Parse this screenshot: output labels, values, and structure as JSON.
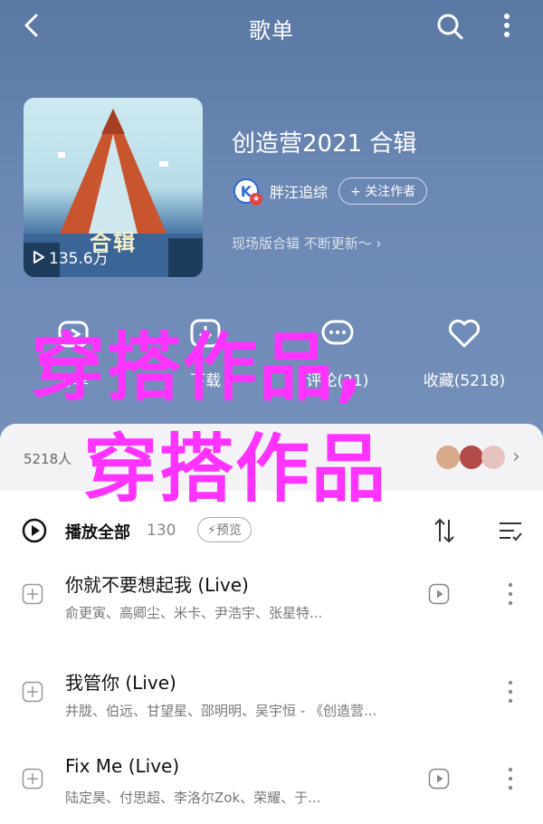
{
  "topbar": {
    "title": "歌单"
  },
  "cover": {
    "art_text": "合辑",
    "play_count": "135.6万"
  },
  "album": {
    "title": "创造营2021 合辑",
    "creator_name": "胖汪追综",
    "follow_label": "+ 关注作者",
    "update_text": "现场版合辑 不断更新～ ›"
  },
  "actions": [
    {
      "label": "分享",
      "icon": "share-icon"
    },
    {
      "label": "下载",
      "icon": "download-icon"
    },
    {
      "label": "评论(21)",
      "icon": "comment-icon"
    },
    {
      "label": "收藏(5218)",
      "icon": "heart-icon"
    }
  ],
  "watermark": {
    "line1": "穿搭作品,",
    "line2": "穿搭作品"
  },
  "fans": {
    "text": "5218人",
    "chevron": "›"
  },
  "playall": {
    "label": "播放全部",
    "count": "130",
    "preview": "⚡预览"
  },
  "songs": [
    {
      "title": "你就不要想起我 (Live)",
      "artists": "俞更寅、高卿尘、米卡、尹浩宇、张星特..."
    },
    {
      "title": "我管你 (Live)",
      "artists": "井胧、伯远、甘望星、邵明明、吴宇恒 - 《创造营..."
    },
    {
      "title": "Fix Me (Live)",
      "artists": "陆定昊、付思超、李洛尔Zok、荣耀、于..."
    }
  ],
  "colors": {
    "hero": "#6b87b3",
    "watermark": "#ff33ff",
    "accent": "#2f6bd6"
  }
}
